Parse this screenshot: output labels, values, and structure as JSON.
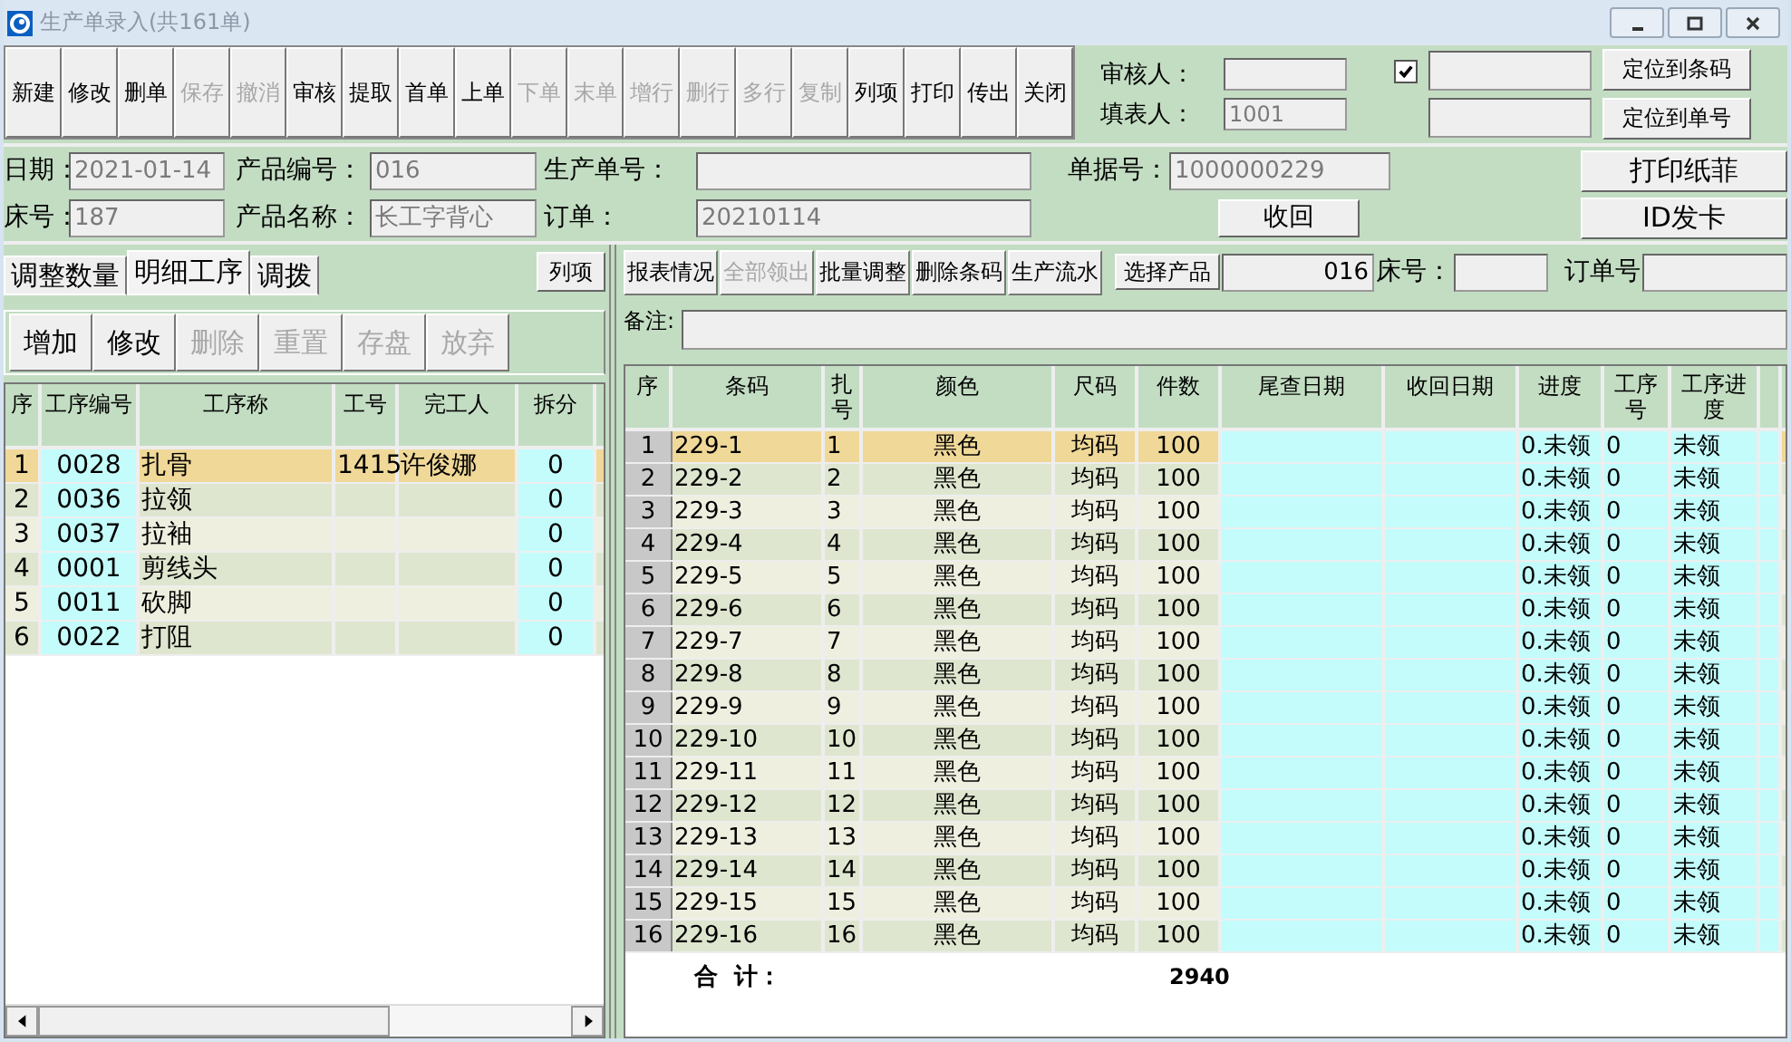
{
  "window": {
    "title": "生产单录入(共161单)"
  },
  "toolbar": [
    {
      "label": "新建",
      "disabled": false
    },
    {
      "label": "修改",
      "disabled": false
    },
    {
      "label": "删单",
      "disabled": false
    },
    {
      "label": "保存",
      "disabled": true
    },
    {
      "label": "撤消",
      "disabled": true
    },
    {
      "label": "审核",
      "disabled": false
    },
    {
      "label": "提取",
      "disabled": false
    },
    {
      "label": "首单",
      "disabled": false
    },
    {
      "label": "上单",
      "disabled": false
    },
    {
      "label": "下单",
      "disabled": true
    },
    {
      "label": "末单",
      "disabled": true
    },
    {
      "label": "增行",
      "disabled": true
    },
    {
      "label": "删行",
      "disabled": true
    },
    {
      "label": "多行",
      "disabled": true
    },
    {
      "label": "复制",
      "disabled": true
    },
    {
      "label": "列项",
      "disabled": false
    },
    {
      "label": "打印",
      "disabled": false
    },
    {
      "label": "传出",
      "disabled": false
    },
    {
      "label": "关闭",
      "disabled": false
    }
  ],
  "approval": {
    "reviewer_label": "审核人：",
    "filler_label": "填表人：",
    "filler": "1001",
    "checked": true,
    "locate_buttons": [
      "定位到条码",
      "定位到单号"
    ]
  },
  "form": {
    "date": {
      "label": "日期：",
      "value": "2021-01-14"
    },
    "product_code": {
      "label": "产品编号：",
      "value": "016"
    },
    "production_no": {
      "label": "生产单号："
    },
    "doc_no": {
      "label": "单据号：",
      "value": "1000000229"
    },
    "bed_no": {
      "label": "床号：",
      "value": "187"
    },
    "product_name": {
      "label": "产品名称：",
      "value": "长工字背心"
    },
    "order": {
      "label": "订单：",
      "value": "20210114"
    },
    "print_button": "打印纸菲",
    "recall_button": "收回",
    "id_button": "ID发卡"
  },
  "left": {
    "tabs": [
      {
        "label": "调整数量",
        "selected": false
      },
      {
        "label": "明细工序",
        "selected": true
      },
      {
        "label": "调拨",
        "selected": false
      }
    ],
    "column_button": "列项",
    "actions": [
      {
        "label": "增加",
        "disabled": false
      },
      {
        "label": "修改",
        "disabled": false
      },
      {
        "label": "删除",
        "disabled": true
      },
      {
        "label": "重置",
        "disabled": true
      },
      {
        "label": "存盘",
        "disabled": true
      },
      {
        "label": "放弃",
        "disabled": true
      }
    ],
    "table": {
      "columns": [
        "序",
        "工序编号",
        "工序称",
        "工号",
        "完工人",
        "拆分"
      ],
      "rows": [
        {
          "no": "1",
          "code": "0028",
          "name": "扎骨",
          "worker_id": "1415",
          "worker": "许俊娜",
          "split": "0",
          "selected": true
        },
        {
          "no": "2",
          "code": "0036",
          "name": "拉领",
          "split": "0",
          "selected": false
        },
        {
          "no": "3",
          "code": "0037",
          "name": "拉袖",
          "split": "0",
          "selected": false
        },
        {
          "no": "4",
          "code": "0001",
          "name": "剪线头",
          "split": "0",
          "selected": false
        },
        {
          "no": "5",
          "code": "0011",
          "name": "砍脚",
          "split": "0",
          "selected": false
        },
        {
          "no": "6",
          "code": "0022",
          "name": "打阻",
          "split": "0",
          "selected": false
        }
      ]
    }
  },
  "right": {
    "actions": [
      {
        "label": "报表情况",
        "disabled": false
      },
      {
        "label": "全部领出",
        "disabled": true
      },
      {
        "label": "批量调整",
        "disabled": false
      },
      {
        "label": "删除条码",
        "disabled": false
      },
      {
        "label": "生产流水",
        "disabled": false
      }
    ],
    "select_button": "选择产品",
    "product_code": "016",
    "bed_label": "床号：",
    "order_label": "订单号",
    "remark_label": "备注:",
    "table": {
      "columns": [
        "序",
        "条码",
        "扎号",
        "颜色",
        "尺码",
        "件数",
        "尾查日期",
        "收回日期",
        "进度",
        "工序号",
        "工序进度"
      ],
      "rows": [
        {
          "no": "1",
          "barcode": "229-1",
          "bundle": "1",
          "colour_name": "黑色",
          "size": "均码",
          "qty": "100",
          "progress": "0.未领",
          "step_no": "0",
          "step_progress": "未领",
          "selected": true
        },
        {
          "no": "2",
          "barcode": "229-2",
          "bundle": "2",
          "colour_name": "黑色",
          "size": "均码",
          "qty": "100",
          "progress": "0.未领",
          "step_no": "0",
          "step_progress": "未领",
          "selected": false
        },
        {
          "no": "3",
          "barcode": "229-3",
          "bundle": "3",
          "colour_name": "黑色",
          "size": "均码",
          "qty": "100",
          "progress": "0.未领",
          "step_no": "0",
          "step_progress": "未领",
          "selected": false
        },
        {
          "no": "4",
          "barcode": "229-4",
          "bundle": "4",
          "colour_name": "黑色",
          "size": "均码",
          "qty": "100",
          "progress": "0.未领",
          "step_no": "0",
          "step_progress": "未领",
          "selected": false
        },
        {
          "no": "5",
          "barcode": "229-5",
          "bundle": "5",
          "colour_name": "黑色",
          "size": "均码",
          "qty": "100",
          "progress": "0.未领",
          "step_no": "0",
          "step_progress": "未领",
          "selected": false
        },
        {
          "no": "6",
          "barcode": "229-6",
          "bundle": "6",
          "colour_name": "黑色",
          "size": "均码",
          "qty": "100",
          "progress": "0.未领",
          "step_no": "0",
          "step_progress": "未领",
          "selected": false
        },
        {
          "no": "7",
          "barcode": "229-7",
          "bundle": "7",
          "colour_name": "黑色",
          "size": "均码",
          "qty": "100",
          "progress": "0.未领",
          "step_no": "0",
          "step_progress": "未领",
          "selected": false
        },
        {
          "no": "8",
          "barcode": "229-8",
          "bundle": "8",
          "colour_name": "黑色",
          "size": "均码",
          "qty": "100",
          "progress": "0.未领",
          "step_no": "0",
          "step_progress": "未领",
          "selected": false
        },
        {
          "no": "9",
          "barcode": "229-9",
          "bundle": "9",
          "colour_name": "黑色",
          "size": "均码",
          "qty": "100",
          "progress": "0.未领",
          "step_no": "0",
          "step_progress": "未领",
          "selected": false
        },
        {
          "no": "10",
          "barcode": "229-10",
          "bundle": "10",
          "colour_name": "黑色",
          "size": "均码",
          "qty": "100",
          "progress": "0.未领",
          "step_no": "0",
          "step_progress": "未领",
          "selected": false
        },
        {
          "no": "11",
          "barcode": "229-11",
          "bundle": "11",
          "colour_name": "黑色",
          "size": "均码",
          "qty": "100",
          "progress": "0.未领",
          "step_no": "0",
          "step_progress": "未领",
          "selected": false
        },
        {
          "no": "12",
          "barcode": "229-12",
          "bundle": "12",
          "colour_name": "黑色",
          "size": "均码",
          "qty": "100",
          "progress": "0.未领",
          "step_no": "0",
          "step_progress": "未领",
          "selected": false
        },
        {
          "no": "13",
          "barcode": "229-13",
          "bundle": "13",
          "colour_name": "黑色",
          "size": "均码",
          "qty": "100",
          "progress": "0.未领",
          "step_no": "0",
          "step_progress": "未领",
          "selected": false
        },
        {
          "no": "14",
          "barcode": "229-14",
          "bundle": "14",
          "colour_name": "黑色",
          "size": "均码",
          "qty": "100",
          "progress": "0.未领",
          "step_no": "0",
          "step_progress": "未领",
          "selected": false
        },
        {
          "no": "15",
          "barcode": "229-15",
          "bundle": "15",
          "colour_name": "黑色",
          "size": "均码",
          "qty": "100",
          "progress": "0.未领",
          "step_no": "0",
          "step_progress": "未领",
          "selected": false
        },
        {
          "no": "16",
          "barcode": "229-16",
          "bundle": "16",
          "colour_name": "黑色",
          "size": "均码",
          "qty": "100",
          "progress": "0.未领",
          "step_no": "0",
          "step_progress": "未领",
          "selected": false
        }
      ]
    },
    "total_label": "合  计：",
    "total": "2940"
  }
}
